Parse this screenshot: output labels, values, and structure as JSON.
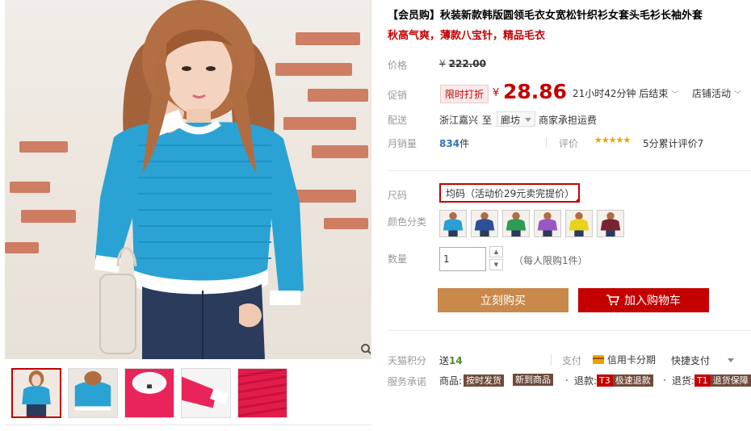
{
  "product": {
    "title": "【会员购】秋装新款韩版圆领毛衣女宽松针织衫女套头毛衫长袖外套",
    "subtitle": "秋高气爽，薄款八宝针，精品毛衣"
  },
  "price": {
    "label": "价格",
    "currency": "¥",
    "original": "222.00",
    "promo_label": "促销",
    "promo_tag": "限时打折",
    "current": "28.86",
    "countdown": "21小时42分钟 后结束",
    "shop_activity": "店铺活动"
  },
  "shipping": {
    "label": "配送",
    "from": "浙江嘉兴",
    "to_word": "至",
    "destination": "廊坊",
    "fee_note": "商家承担运费"
  },
  "sales": {
    "label": "月销量",
    "count": "834",
    "unit": "件",
    "review_label": "评价",
    "stars": "★★★★★",
    "rating_text": "5分累计评价7",
    "rating": 5
  },
  "size": {
    "label": "尺码",
    "selected": "均码（活动价29元卖完提价）"
  },
  "color": {
    "label": "颜色分类",
    "options": [
      {
        "name": "blue",
        "hex": "#2a9fd6"
      },
      {
        "name": "navy",
        "hex": "#2c4f9a"
      },
      {
        "name": "green",
        "hex": "#2e9c54"
      },
      {
        "name": "purple",
        "hex": "#9a56c4"
      },
      {
        "name": "yellow",
        "hex": "#e9d21a"
      },
      {
        "name": "wine",
        "hex": "#7a2231"
      }
    ]
  },
  "quantity": {
    "label": "数量",
    "value": "1",
    "limit_note": "（每人限购1件）"
  },
  "actions": {
    "buy_now": "立刻购买",
    "add_to_cart": "加入购物车"
  },
  "tmall": {
    "points_label": "天猫积分",
    "points_prefix": "送",
    "points_value": "14",
    "pay_label": "支付",
    "card_pay": "信用卡分期",
    "quick_pay": "快捷支付"
  },
  "service": {
    "label": "服务承诺",
    "item1_prefix": "商品:",
    "item1_tag": "按时发货",
    "item2_tag": "新到商品",
    "item3_prefix": "退款:",
    "item3_tag_red": "T3",
    "item3_tag": "极速退款",
    "item4_prefix": "退货:",
    "item4_tag_red": "T1",
    "item4_tag": "退货保障"
  },
  "colors": {
    "accent": "#c40000",
    "buy_button": "#c9894b",
    "sweater": "#2aa3d4",
    "link": "#2e72b8"
  }
}
